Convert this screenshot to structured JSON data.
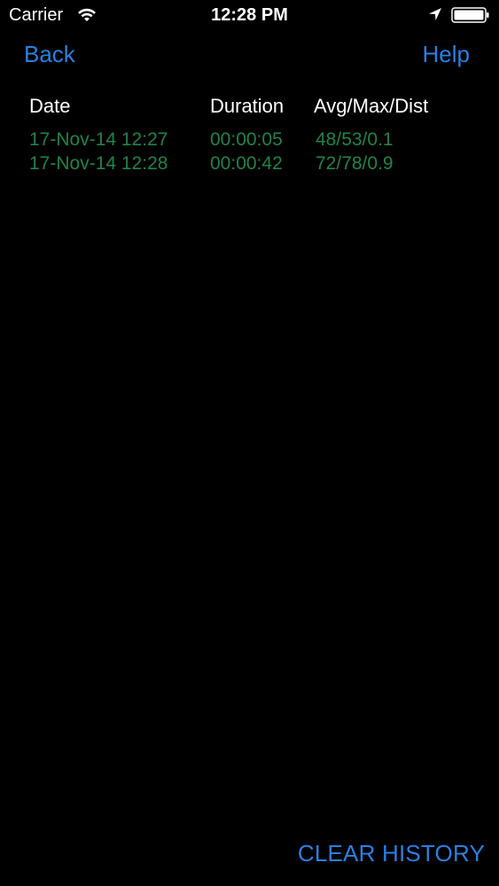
{
  "status_bar": {
    "carrier": "Carrier",
    "time": "12:28 PM",
    "icons": [
      "wifi-icon",
      "location-arrow-icon",
      "battery-icon"
    ]
  },
  "nav": {
    "back_label": "Back",
    "help_label": "Help"
  },
  "table": {
    "headers": {
      "date": "Date",
      "duration": "Duration",
      "avg_max_dist": "Avg/Max/Dist"
    },
    "rows": [
      {
        "date": "17-Nov-14 12:27",
        "duration": "00:00:05",
        "avg_max_dist": "48/53/0.1"
      },
      {
        "date": "17-Nov-14 12:28",
        "duration": "00:00:42",
        "avg_max_dist": "72/78/0.9"
      }
    ]
  },
  "footer": {
    "clear_history_label": "CLEAR HISTORY"
  },
  "colors": {
    "background": "#000000",
    "accent_blue": "#2d7fe0",
    "row_green": "#23824a",
    "header_text": "#ffffff"
  }
}
